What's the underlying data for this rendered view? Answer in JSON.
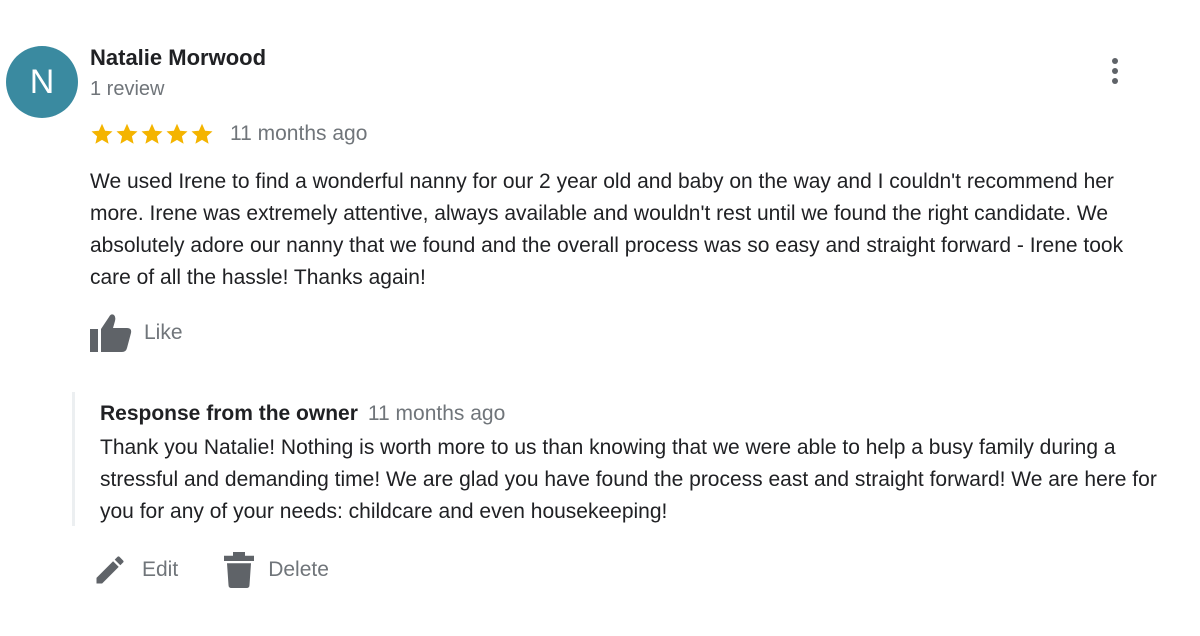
{
  "review": {
    "avatar_letter": "N",
    "author_name": "Natalie Morwood",
    "review_count": "1 review",
    "rating": 5,
    "star_color": "#f4b400",
    "date": "11 months ago",
    "text": "We used Irene to find a wonderful nanny for our 2 year old and baby on the way and I couldn't recommend her more. Irene was extremely attentive, always available and wouldn't rest until we found the right candidate. We absolutely adore our nanny that we found and the overall process was so easy and straight forward - Irene took care of all the hassle! Thanks again!",
    "like_label": "Like",
    "more_icon": "more-vert-icon"
  },
  "response": {
    "title": "Response from the owner",
    "date": "11 months ago",
    "text": "Thank you Natalie! Nothing is worth more to us than knowing that we were able to help a busy family during a stressful and demanding time! We are glad you have found the process east and straight forward! We are here for you for any of your needs: childcare and even housekeeping!"
  },
  "actions": {
    "edit_label": "Edit",
    "delete_label": "Delete"
  },
  "colors": {
    "avatar_bg": "#3a8aa0",
    "icon_gray": "#5f6368",
    "secondary_text": "#70757a"
  }
}
